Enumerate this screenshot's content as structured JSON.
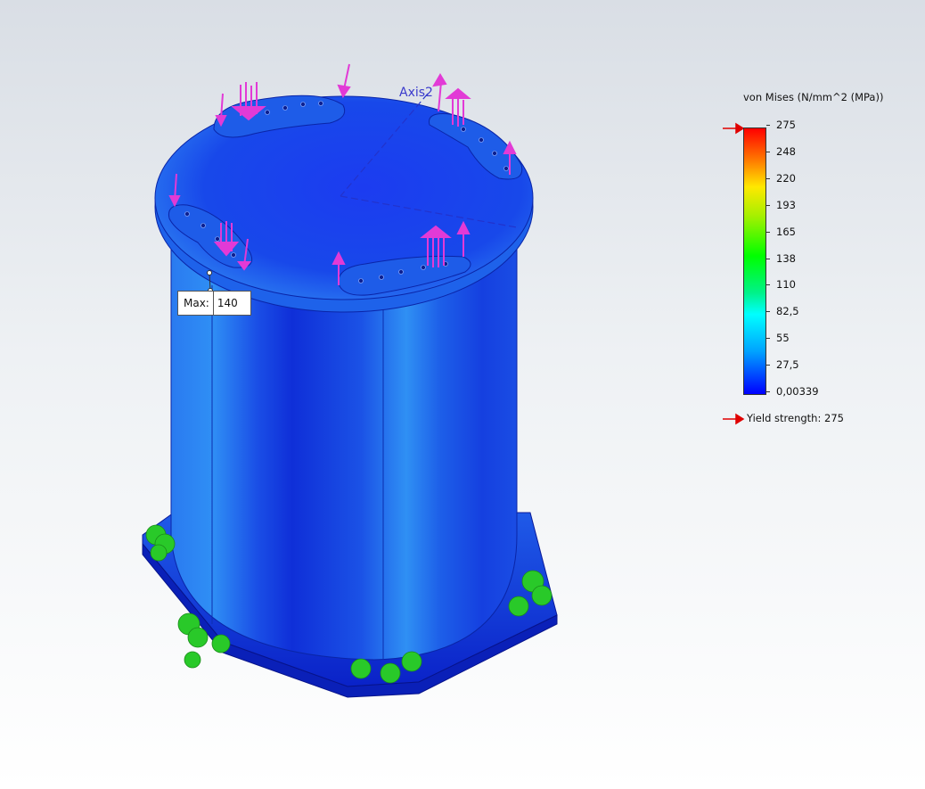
{
  "viewport": {
    "axis_label": "Axis2",
    "max_probe": {
      "label": "Max:",
      "value": "140"
    }
  },
  "legend": {
    "title": "von Mises (N/mm^2 (MPa))",
    "ticks": [
      "275",
      "248",
      "220",
      "193",
      "165",
      "138",
      "110",
      "82,5",
      "55",
      "27,5",
      "0,00339"
    ],
    "yield_label": "Yield strength: 275"
  },
  "colors": {
    "load_arrows": "#e23ad6",
    "fixture_arrows": "#29c929",
    "model_blue": "#1540e0",
    "marker_red": "#e00000"
  },
  "icons": {
    "yield_marker": "red-arrow-marker",
    "colorbar_top_marker": "red-arrow-marker"
  }
}
